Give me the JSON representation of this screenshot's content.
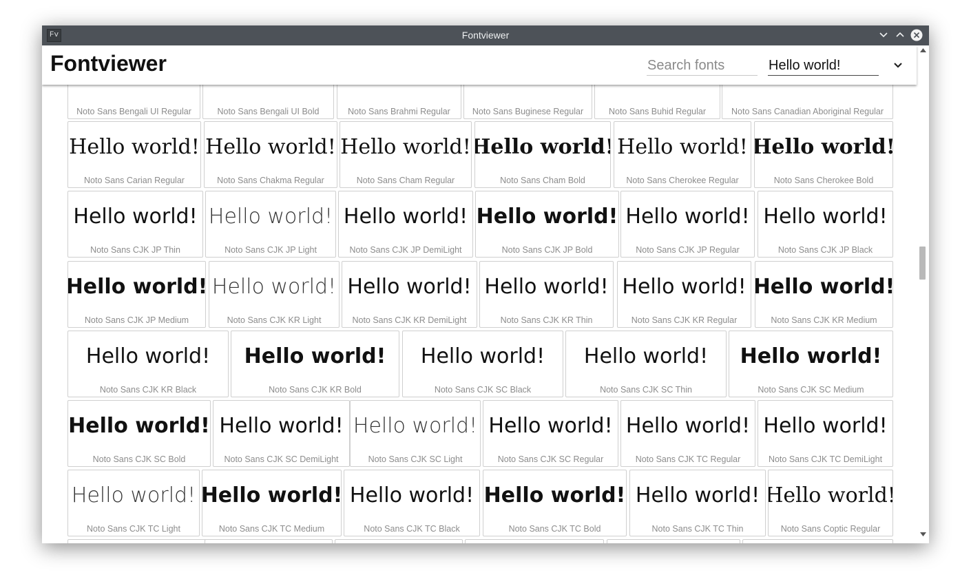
{
  "window": {
    "title": "Fontviewer",
    "app_icon_label": "Fv"
  },
  "header": {
    "app_title": "Fontviewer",
    "search_placeholder": "Search fonts",
    "search_value": "",
    "sample_text_value": "Hello world!"
  },
  "sample_text": "Hello world!",
  "fonts": [
    {
      "name": "Noto Sans Bengali UI Regular"
    },
    {
      "name": "Noto Sans Bengali UI Bold"
    },
    {
      "name": "Noto Sans Brahmi Regular"
    },
    {
      "name": "Noto Sans Buginese Regular"
    },
    {
      "name": "Noto Sans Buhid Regular"
    },
    {
      "name": "Noto Sans Canadian Aboriginal Regular"
    },
    {
      "name": "Noto Sans Carian Regular"
    },
    {
      "name": "Noto Sans Chakma Regular"
    },
    {
      "name": "Noto Sans Cham Regular"
    },
    {
      "name": "Noto Sans Cham Bold"
    },
    {
      "name": "Noto Sans Cherokee Regular"
    },
    {
      "name": "Noto Sans Cherokee Bold"
    },
    {
      "name": "Noto Sans CJK JP Thin"
    },
    {
      "name": "Noto Sans CJK JP Light"
    },
    {
      "name": "Noto Sans CJK JP DemiLight"
    },
    {
      "name": "Noto Sans CJK JP Bold"
    },
    {
      "name": "Noto Sans CJK JP Regular"
    },
    {
      "name": "Noto Sans CJK JP Black"
    },
    {
      "name": "Noto Sans CJK JP Medium"
    },
    {
      "name": "Noto Sans CJK KR Light"
    },
    {
      "name": "Noto Sans CJK KR DemiLight"
    },
    {
      "name": "Noto Sans CJK KR Thin"
    },
    {
      "name": "Noto Sans CJK KR Regular"
    },
    {
      "name": "Noto Sans CJK KR Medium"
    },
    {
      "name": "Noto Sans CJK KR Black"
    },
    {
      "name": "Noto Sans CJK KR Bold"
    },
    {
      "name": "Noto Sans CJK SC Black"
    },
    {
      "name": "Noto Sans CJK SC Thin"
    },
    {
      "name": "Noto Sans CJK SC Medium"
    },
    {
      "name": "Noto Sans CJK SC Bold"
    },
    {
      "name": "Noto Sans CJK SC DemiLight"
    },
    {
      "name": "Noto Sans CJK SC Light"
    },
    {
      "name": "Noto Sans CJK SC Regular"
    },
    {
      "name": "Noto Sans CJK TC Regular"
    },
    {
      "name": "Noto Sans CJK TC DemiLight"
    },
    {
      "name": "Noto Sans CJK TC Light"
    },
    {
      "name": "Noto Sans CJK TC Medium"
    },
    {
      "name": "Noto Sans CJK TC Black"
    },
    {
      "name": "Noto Sans CJK TC Bold"
    },
    {
      "name": "Noto Sans CJK TC Thin"
    },
    {
      "name": "Noto Sans Coptic Regular"
    }
  ],
  "icons": {
    "minimize": "chevron-down-icon",
    "maximize": "chevron-up-icon",
    "close": "close-icon",
    "dropdown": "chevron-down-icon"
  },
  "colors": {
    "titlebar": "#4d5258",
    "tile_border": "#cfcfcf",
    "font_name": "#8c8c8c"
  }
}
